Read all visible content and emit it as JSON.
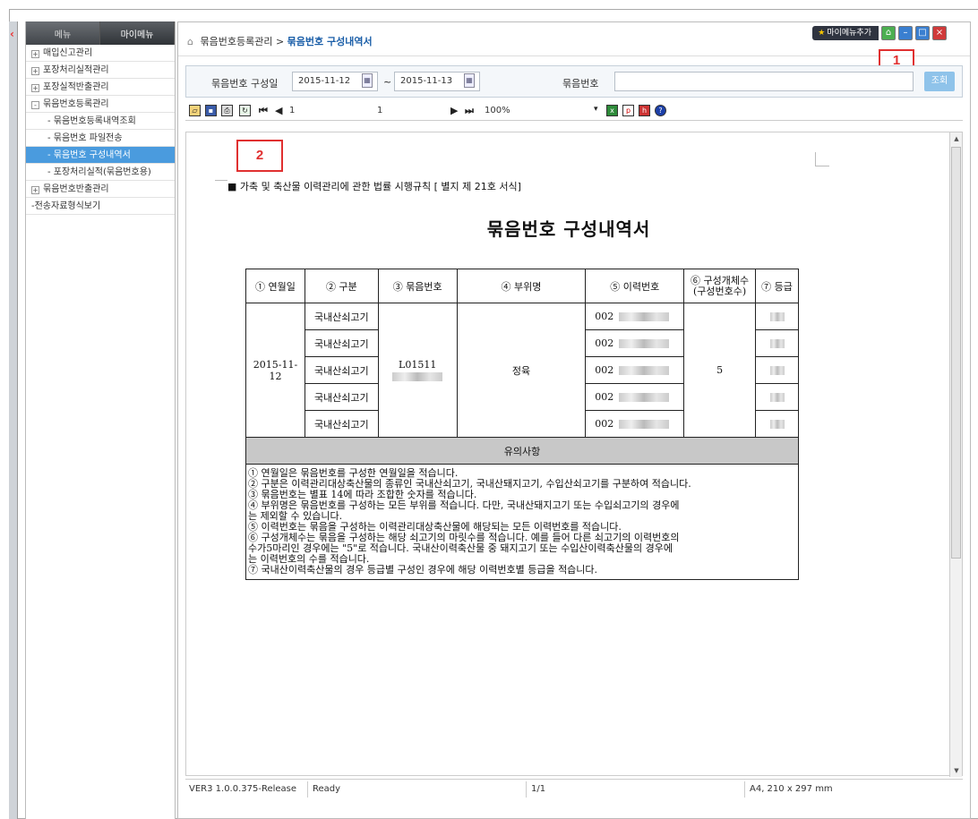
{
  "sidebar": {
    "tabs": [
      "메뉴",
      "마이메뉴"
    ],
    "items": [
      {
        "label": "매입신고관리",
        "type": "collapsed"
      },
      {
        "label": "포장처리실적관리",
        "type": "collapsed"
      },
      {
        "label": "포장실적반출관리",
        "type": "collapsed"
      },
      {
        "label": "묶음번호등록관리",
        "type": "expanded"
      },
      {
        "label": "- 묶음번호등록내역조회",
        "type": "sub"
      },
      {
        "label": "- 묶음번호 파일전송",
        "type": "sub"
      },
      {
        "label": "- 묶음번호 구성내역서",
        "type": "sub",
        "selected": true
      },
      {
        "label": "- 포장처리실적(묶음번호용)",
        "type": "sub"
      },
      {
        "label": "묶음번호반출관리",
        "type": "collapsed"
      },
      {
        "label": "-전송자료형식보기",
        "type": "plain"
      }
    ]
  },
  "header": {
    "breadcrumb_parent": "묶음번호등록관리",
    "breadcrumb_sep": ">",
    "breadcrumb_current": "묶음번호 구성내역서",
    "mymenu_add": "마이메뉴추가"
  },
  "callouts": [
    "1",
    "2"
  ],
  "search": {
    "date_label": "묶음번호 구성일",
    "date_from": "2015-11-12",
    "tilde": "~",
    "date_to": "2015-11-13",
    "bundle_label": "묶음번호",
    "bundle_value": "",
    "search_button": "조회"
  },
  "toolbar": {
    "page_current": "1",
    "page_total": "1",
    "zoom": "100%"
  },
  "document": {
    "law_text": "■ 가축 및 축산물 이력관리에 관한 법률 시행규칙 [ 별지 제 21호 서식]",
    "title": "묶음번호 구성내역서",
    "headers": [
      "① 연월일",
      "② 구분",
      "③ 묶음번호",
      "④ 부위명",
      "⑤ 이력번호",
      "⑥ 구성개체수\n(구성번호수)",
      "⑦ 등급"
    ],
    "date": "2015-11-12",
    "bundle_no": "L01511",
    "part_name": "정육",
    "count": "5",
    "rows": [
      {
        "category": "국내산쇠고기",
        "trace_no": "002"
      },
      {
        "category": "국내산쇠고기",
        "trace_no": "002"
      },
      {
        "category": "국내산쇠고기",
        "trace_no": "002"
      },
      {
        "category": "국내산쇠고기",
        "trace_no": "002"
      },
      {
        "category": "국내산쇠고기",
        "trace_no": "002"
      }
    ],
    "notice_header": "유의사항",
    "notes": [
      "① 연월일은 묶음번호를 구성한 연월일을 적습니다.",
      "② 구분은 이력관리대상축산물의 종류인 국내산쇠고기, 국내산돼지고기, 수입산쇠고기를 구분하여 적습니다.",
      "③ 묶음번호는 별표 14에 따라 조합한 숫자를 적습니다.",
      "④ 부위명은 묶음번호를 구성하는 모든 부위를 적습니다.  다만, 국내산돼지고기 또는 수입쇠고기의 경우에",
      "는 제외할 수 있습니다.",
      "⑤ 이력번호는 묶음을 구성하는 이력관리대상축산물에 해당되는 모든 이력번호를 적습니다.",
      "⑥ 구성개체수는 묶음을 구성하는 해당 쇠고기의 마릿수를 적습니다. 예를 들어 다른 쇠고기의 이력번호의",
      "수가5마리인 경우에는 \"5\"로 적습니다. 국내산이력축산물 중 돼지고기 또는 수입산이력축산물의 경우에",
      "는 이력번호의 수를 적습니다.",
      "⑦ 국내산이력축산물의 경우 등급별 구성인 경우에 해당 이력번호별 등급을 적습니다."
    ]
  },
  "status": {
    "version": "VER3 1.0.0.375-Release",
    "state": "Ready",
    "page": "1/1",
    "paper": "A4, 210 x 297 mm"
  }
}
